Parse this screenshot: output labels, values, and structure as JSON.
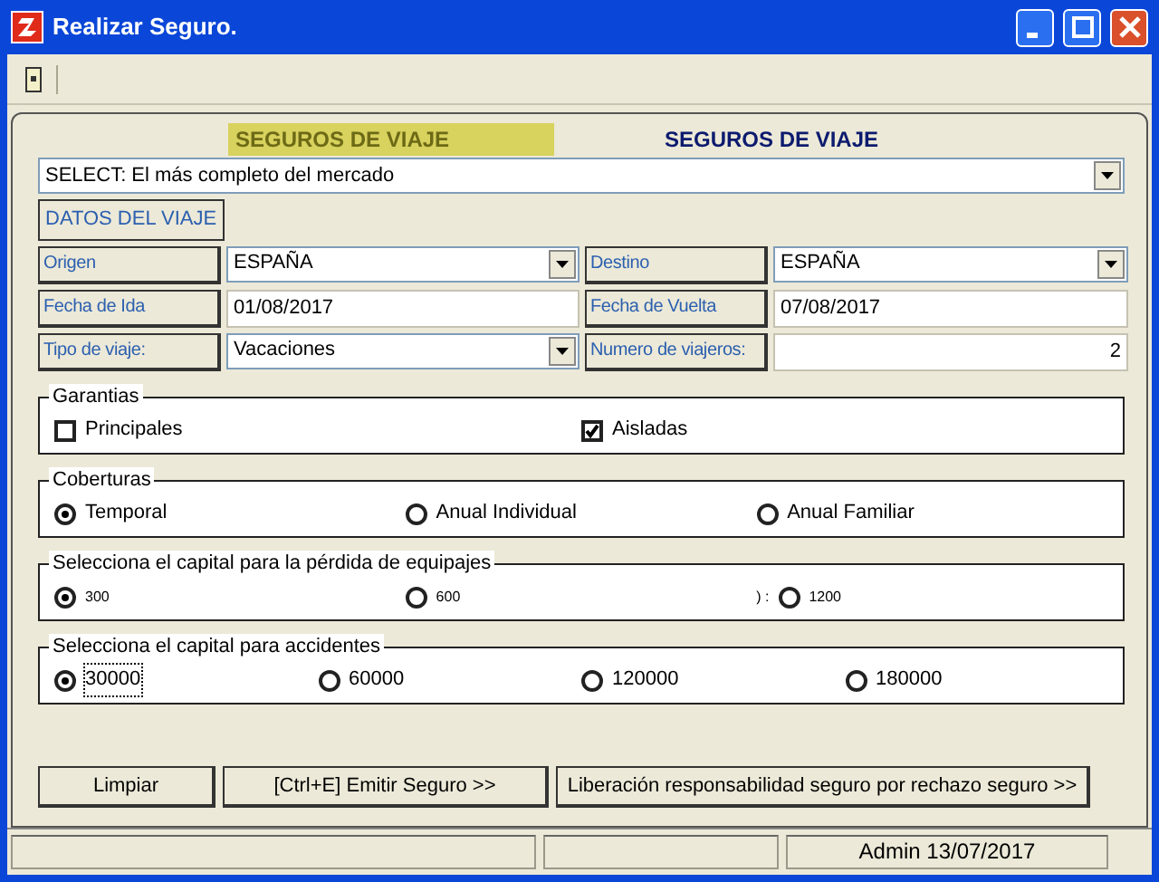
{
  "window": {
    "title": "Realizar Seguro."
  },
  "headers": [
    {
      "label": "SEGUROS DE VIAJE",
      "selected": true
    },
    {
      "label": "SEGUROS DE VIAJE",
      "selected": false
    }
  ],
  "product_select": {
    "value": "SELECT: El más completo del mercado"
  },
  "section_label": "DATOS DEL VIAJE",
  "fields": [
    {
      "label": "Origen",
      "value": "ESPAÑA",
      "kind": "combo"
    },
    {
      "label": "Destino",
      "value": "ESPAÑA",
      "kind": "combo"
    },
    {
      "label": "Fecha de Ida",
      "value": "01/08/2017",
      "kind": "text"
    },
    {
      "label": "Fecha de Vuelta",
      "value": "07/08/2017",
      "kind": "text"
    },
    {
      "label": "Tipo de viaje:",
      "value": "Vacaciones",
      "kind": "combo"
    },
    {
      "label": "Numero de viajeros:",
      "value": "2",
      "kind": "number"
    }
  ],
  "groups": [
    {
      "title": "Garantias",
      "kind": "checkbox",
      "options": [
        {
          "label": "Principales",
          "checked": false
        },
        {
          "label": "Aisladas",
          "checked": true
        }
      ]
    },
    {
      "title": "Coberturas",
      "kind": "radio",
      "options": [
        {
          "label": "Temporal",
          "selected": true
        },
        {
          "label": "Anual Individual",
          "selected": false
        },
        {
          "label": "Anual Familiar",
          "selected": false
        }
      ]
    },
    {
      "title": "Selecciona el capital para la pérdida de equipajes",
      "kind": "radio-small",
      "options": [
        {
          "label": "300",
          "selected": true
        },
        {
          "label": "600",
          "selected": false
        },
        {
          "label": "1200",
          "selected": false,
          "prefix": ") :"
        }
      ]
    },
    {
      "title": "Selecciona el capital para accidentes",
      "kind": "radio",
      "options": [
        {
          "label": "30000",
          "selected": true,
          "focused": true
        },
        {
          "label": "60000",
          "selected": false
        },
        {
          "label": "120000",
          "selected": false
        },
        {
          "label": "180000",
          "selected": false
        }
      ]
    }
  ],
  "buttons": [
    "Limpiar",
    "[Ctrl+E] Emitir Seguro >>",
    "Liberación responsabilidad seguro por rechazo seguro >>"
  ],
  "status_bar": {
    "text": "Admin 13/07/2017"
  }
}
